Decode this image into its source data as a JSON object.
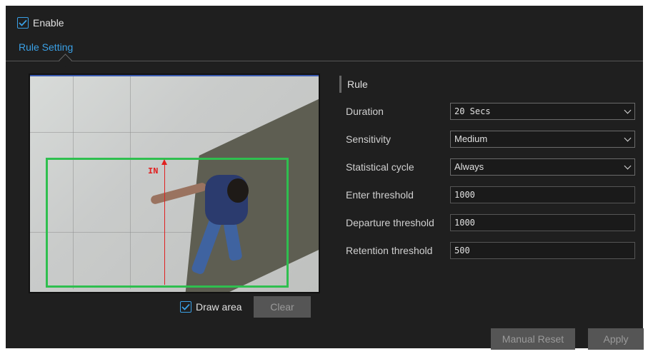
{
  "enable": {
    "label": "Enable",
    "checked": true
  },
  "tabs": [
    {
      "label": "Rule Setting",
      "active": true
    }
  ],
  "video": {
    "direction_label": "IN",
    "watermark": ""
  },
  "draw_area": {
    "label": "Draw area",
    "checked": true
  },
  "clear_button": {
    "label": "Clear"
  },
  "rule": {
    "title": "Rule",
    "duration": {
      "label": "Duration",
      "value": "20 Secs"
    },
    "sensitivity": {
      "label": "Sensitivity",
      "value": "Medium"
    },
    "statistical_cycle": {
      "label": "Statistical cycle",
      "value": "Always"
    },
    "enter_threshold": {
      "label": "Enter threshold",
      "value": "1000"
    },
    "departure_threshold": {
      "label": "Departure threshold",
      "value": "1000"
    },
    "retention_threshold": {
      "label": "Retention threshold",
      "value": "500"
    }
  },
  "footer": {
    "manual_reset_label": "Manual Reset",
    "apply_label": "Apply"
  },
  "colors": {
    "accent": "#3aa0e6",
    "detection_area": "#2fbf4f",
    "line": "#e02020",
    "panel_bg": "#1f1f1f"
  }
}
